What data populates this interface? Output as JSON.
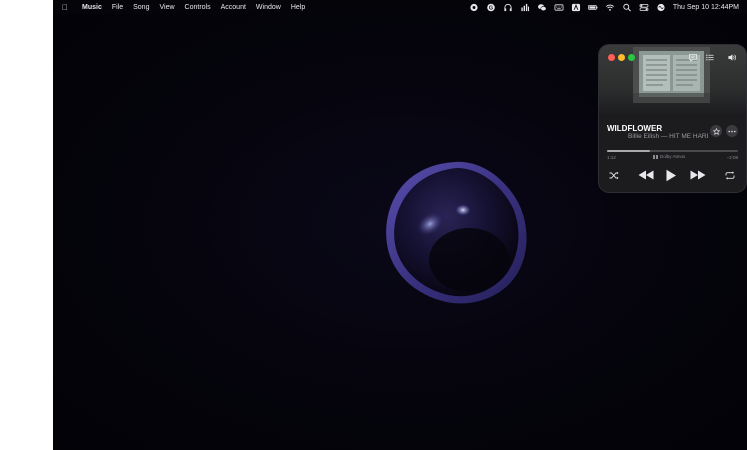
{
  "menubar": {
    "apple_icon": "apple-logo-icon",
    "items": [
      "Music",
      "File",
      "Song",
      "View",
      "Controls",
      "Account",
      "Window",
      "Help"
    ],
    "clock": "Thu Sep 10  12:44PM",
    "tray_icons": [
      "record-icon",
      "grammarly-icon",
      "headphones-icon",
      "chart-icon",
      "wechat-icon",
      "keyboard-icon",
      "adobe-icon",
      "battery-icon",
      "wifi-icon",
      "search-icon",
      "control-center-icon",
      "siri-icon"
    ]
  },
  "mini_player": {
    "track_title": "WILDFLOWER",
    "artist_album": "Billie Eilish — HIT ME HARD AND SOFT",
    "elapsed": "1:12",
    "remaining": "−2:08",
    "audio_format": "Dolby Atmos",
    "progress_fraction": 0.33,
    "icons": {
      "lyrics": "lyrics-icon",
      "queue": "queue-list-icon",
      "volume": "speaker-icon",
      "star": "star-icon",
      "more": "ellipsis-icon",
      "shuffle": "shuffle-icon",
      "previous": "rewind-icon",
      "play": "play-icon",
      "next": "fast-forward-icon",
      "repeat": "repeat-icon"
    }
  },
  "colors": {
    "accent_orb": "#3a3280",
    "background": "#04030a",
    "player_bg": "#1c1c1f"
  }
}
